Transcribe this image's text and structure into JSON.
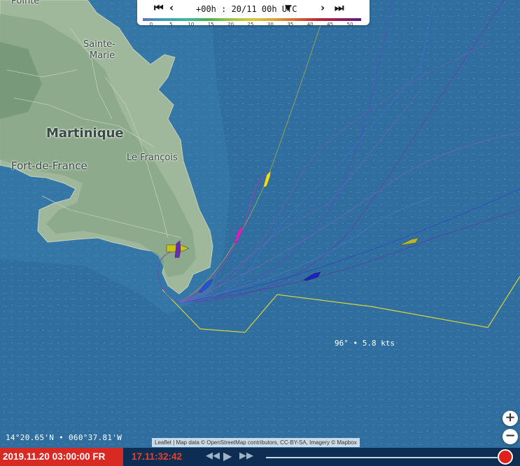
{
  "wind_control": {
    "first_icon": "skip-first",
    "prev_icon": "step-back",
    "time_label": "+00h : 20/11 00h UTC",
    "dropdown_icon": "caret-down",
    "next_icon": "step-forward",
    "last_icon": "skip-last",
    "scale_labels": [
      "0",
      "5",
      "10",
      "15",
      "20",
      "25",
      "30",
      "35",
      "40",
      "45",
      "50"
    ],
    "scale_colors": [
      "#6271b7",
      "#39a0b8",
      "#3cb5a3",
      "#45b14c",
      "#96c246",
      "#d7c63a",
      "#dba13a",
      "#d46632",
      "#b9283b",
      "#8f1d57",
      "#5e1c83"
    ]
  },
  "map": {
    "places": [
      {
        "name": "Pointe",
        "key": "pointe"
      },
      {
        "name": "Sainte-",
        "key": "sainte1"
      },
      {
        "name": "Marie",
        "key": "sainte2"
      },
      {
        "name": "Martinique",
        "key": "martinique"
      },
      {
        "name": "Le François",
        "key": "francois"
      },
      {
        "name": "Fort-de-France",
        "key": "fdf"
      }
    ],
    "boat_colors": [
      "#e7e01a",
      "#d820c6",
      "#1e55e0",
      "#2020c8",
      "#b7b52a",
      "#c6c21c"
    ],
    "layline_color": "#d7d43a"
  },
  "cursor_coords": "14°20.65'N • 060°37.81'W",
  "wind_info": "96° • 5.8 kts",
  "attribution": "Leaflet | Map data © OpenStreetMap contributors, CC-BY-SA, Imagery © Mapbox",
  "zoom": {
    "in": "+",
    "out": "−"
  },
  "playback": {
    "datetime": "2019.11.20 03:00:00 FR",
    "elapsed": "17.11:32:42",
    "rewind_icon": "rewind",
    "play_icon": "play",
    "forward_icon": "fast-forward",
    "progress": 1.0
  }
}
